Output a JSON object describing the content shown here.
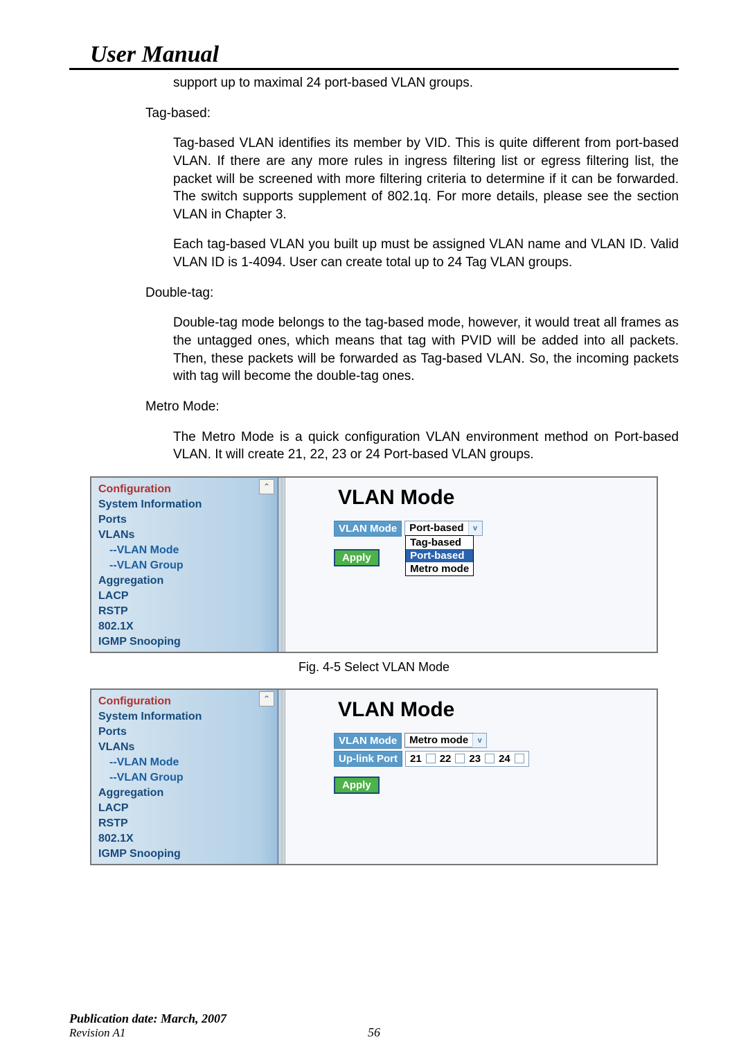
{
  "header": {
    "title": "User Manual"
  },
  "paragraphs": {
    "p1": "support up to maximal 24 port-based VLAN groups.",
    "tagbased_label": "Tag-based:",
    "tagbased_p1": "Tag-based VLAN identifies its member by VID. This is quite different from port-based VLAN. If there are any more rules in ingress filtering list or egress filtering list, the packet will be screened with more filtering criteria to determine if it can be forwarded. The switch supports supplement of 802.1q. For more details, please see the section VLAN in Chapter 3.",
    "tagbased_p2": "Each tag-based VLAN you built up must be assigned VLAN name and VLAN ID. Valid VLAN ID is 1-4094. User can create total up to 24 Tag VLAN groups.",
    "doubletag_label": "Double-tag:",
    "doubletag_p1": "Double-tag mode belongs to the tag-based mode, however, it would treat all frames as the untagged ones, which means that tag with PVID will be added into all packets. Then, these packets will be forwarded as Tag-based VLAN. So, the incoming packets with tag will become the double-tag ones.",
    "metro_label": "Metro Mode:",
    "metro_p1": "The Metro Mode is a quick configuration VLAN environment method on Port-based VLAN. It will create 21, 22, 23 or 24 Port-based VLAN groups."
  },
  "nav": {
    "configuration": "Configuration",
    "sys_info": "System Information",
    "ports": "Ports",
    "vlans": "VLANs",
    "vlan_mode": "--VLAN Mode",
    "vlan_group": "--VLAN Group",
    "aggregation": "Aggregation",
    "lacp": "LACP",
    "rstp": "RSTP",
    "x8021": "802.1X",
    "igmp": "IGMP Snooping"
  },
  "fig1": {
    "title": "VLAN Mode",
    "vlan_mode_label": "VLAN Mode",
    "vlan_mode_value": "Port-based",
    "dropdown": {
      "opt1": "Tag-based",
      "opt2": "Port-based",
      "opt3": "Metro mode"
    },
    "apply": "Apply",
    "caption": "Fig. 4-5 Select VLAN Mode"
  },
  "fig2": {
    "title": "VLAN Mode",
    "vlan_mode_label": "VLAN Mode",
    "vlan_mode_value": "Metro mode",
    "uplink_label": "Up-link Port",
    "uplink_ports": {
      "p21": "21",
      "p22": "22",
      "p23": "23",
      "p24": "24"
    },
    "apply": "Apply"
  },
  "footer": {
    "pub_date": "Publication date: March, 2007",
    "revision": "Revision A1",
    "page": "56"
  }
}
